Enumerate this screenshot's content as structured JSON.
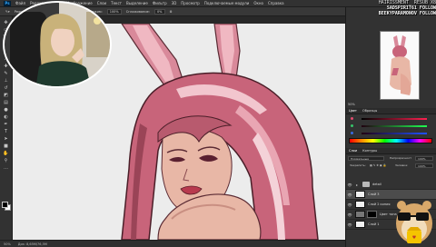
{
  "app": {
    "logo": "Ps"
  },
  "menubar": {
    "items": [
      "Файл",
      "Редактирование",
      "Изображение",
      "Слои",
      "Текст",
      "Выделение",
      "Фильтр",
      "3D",
      "Просмотр",
      "Подключаемые модули",
      "Окно",
      "Справка"
    ]
  },
  "options": {
    "mode_label": "Режим:",
    "mode_value": "Норм",
    "opacity_label": "Непрозр.:",
    "opacity_value": "100%",
    "flow_label": "Нажим:",
    "flow_value": "100%",
    "smoothing_label": "Сглаживание:",
    "smoothing_value": "0%"
  },
  "document": {
    "tab_label": "Безымянный-1 @ 50% (Слой 3, RGB/8)"
  },
  "status": {
    "zoom": "50%",
    "doc_size": "Док: 8,65M/76,5M"
  },
  "hud": {
    "line1": "HAIRISSMENT_ RESUB X8",
    "line2": "SADSPIRIT61 FOLLOW",
    "line3": "BEEKYPARAMONOV FOLLOW"
  },
  "navigator": {
    "zoom_readout": "50%"
  },
  "colors_panel": {
    "tab1": "Цвет",
    "tab2": "Образцы"
  },
  "layers_panel": {
    "tab1": "Слои",
    "tab2": "Контуры",
    "blend_mode": "Нормальные",
    "opacity_label": "Непрозрачность:",
    "opacity_value": "100%",
    "lock_label": "Закрепить:",
    "fill_label": "Заливка:",
    "fill_value": "100%",
    "layers": [
      {
        "name": "detail",
        "type": "folder",
        "selected": false
      },
      {
        "name": "Слой 3",
        "type": "layer",
        "selected": true
      },
      {
        "name": "Слой 2 копия",
        "type": "layer",
        "selected": false
      },
      {
        "name": "Цвет тона 1",
        "type": "adjustment",
        "selected": false
      },
      {
        "name": "Слой 1",
        "type": "layer",
        "selected": false
      }
    ]
  },
  "colors": {
    "canvas_bg": "#ececec",
    "hair_pink": "#c8647a",
    "skin": "#e8b7a6",
    "accent_yellow": "#f5c400"
  }
}
